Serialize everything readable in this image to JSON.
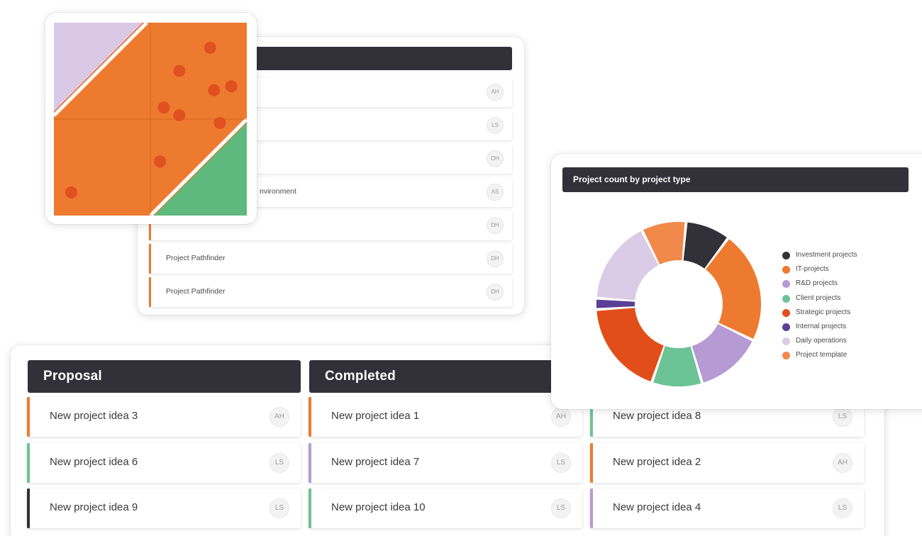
{
  "colors": {
    "header_bg": "#32313a",
    "orange": "#ee7a30",
    "lavender": "#b69ad4",
    "green": "#6cc395",
    "dark": "#32313a",
    "light_lavender": "#d9c8e6",
    "matrix_green": "#5fb97e",
    "dot_red": "#e05020"
  },
  "project_list": {
    "header_title": "",
    "rows": [
      {
        "name": "",
        "assignee": "AH"
      },
      {
        "name": "",
        "assignee": "LS"
      },
      {
        "name": "",
        "assignee": "DH"
      },
      {
        "name": "nvironment",
        "assignee": "AS"
      },
      {
        "name": "",
        "assignee": "DH"
      },
      {
        "name": "Project Pathfinder",
        "assignee": "DH"
      },
      {
        "name": "Project Pathfinder",
        "assignee": "DH"
      }
    ]
  },
  "board": {
    "columns": [
      {
        "title": "Proposal",
        "cards": [
          {
            "name": "New project idea 3",
            "assignee": "AH",
            "color": "#ee7a30"
          },
          {
            "name": "New project idea 6",
            "assignee": "LS",
            "color": "#6cc395"
          },
          {
            "name": "New project idea 9",
            "assignee": "LS",
            "color": "#32313a"
          }
        ]
      },
      {
        "title": "Completed",
        "cards": [
          {
            "name": "New project idea 1",
            "assignee": "AH",
            "color": "#ee7a30"
          },
          {
            "name": "New project idea 7",
            "assignee": "LS",
            "color": "#b69ad4"
          },
          {
            "name": "New project idea 10",
            "assignee": "LS",
            "color": "#6cc395"
          }
        ]
      },
      {
        "title": "",
        "cards": [
          {
            "name": "New project idea 8",
            "assignee": "LS",
            "color": "#6cc395"
          },
          {
            "name": "New project idea 2",
            "assignee": "AH",
            "color": "#ee7a30"
          },
          {
            "name": "New project idea 4",
            "assignee": "LS",
            "color": "#b69ad4"
          }
        ]
      }
    ]
  },
  "matrix": {
    "points": [
      {
        "x": 0.81,
        "y": 0.87
      },
      {
        "x": 0.65,
        "y": 0.75
      },
      {
        "x": 0.83,
        "y": 0.65
      },
      {
        "x": 0.92,
        "y": 0.67
      },
      {
        "x": 0.57,
        "y": 0.56
      },
      {
        "x": 0.65,
        "y": 0.52
      },
      {
        "x": 0.86,
        "y": 0.48
      },
      {
        "x": 0.55,
        "y": 0.28
      },
      {
        "x": 0.09,
        "y": 0.12
      }
    ]
  },
  "chart_data": {
    "type": "pie",
    "title": "Project count by project type",
    "legend_position": "right",
    "categories": [
      "Investment projects",
      "IT-projects",
      "R&D projects",
      "Client projects",
      "Strategic projects",
      "Internal projects",
      "Daily operations",
      "Project template"
    ],
    "values": [
      8,
      20,
      12,
      9,
      17,
      2,
      15,
      8
    ],
    "colors": [
      "#32313a",
      "#ee7a30",
      "#b69ad4",
      "#6cc395",
      "#e14e1a",
      "#5b3e96",
      "#dacbe6",
      "#f0894a"
    ]
  }
}
